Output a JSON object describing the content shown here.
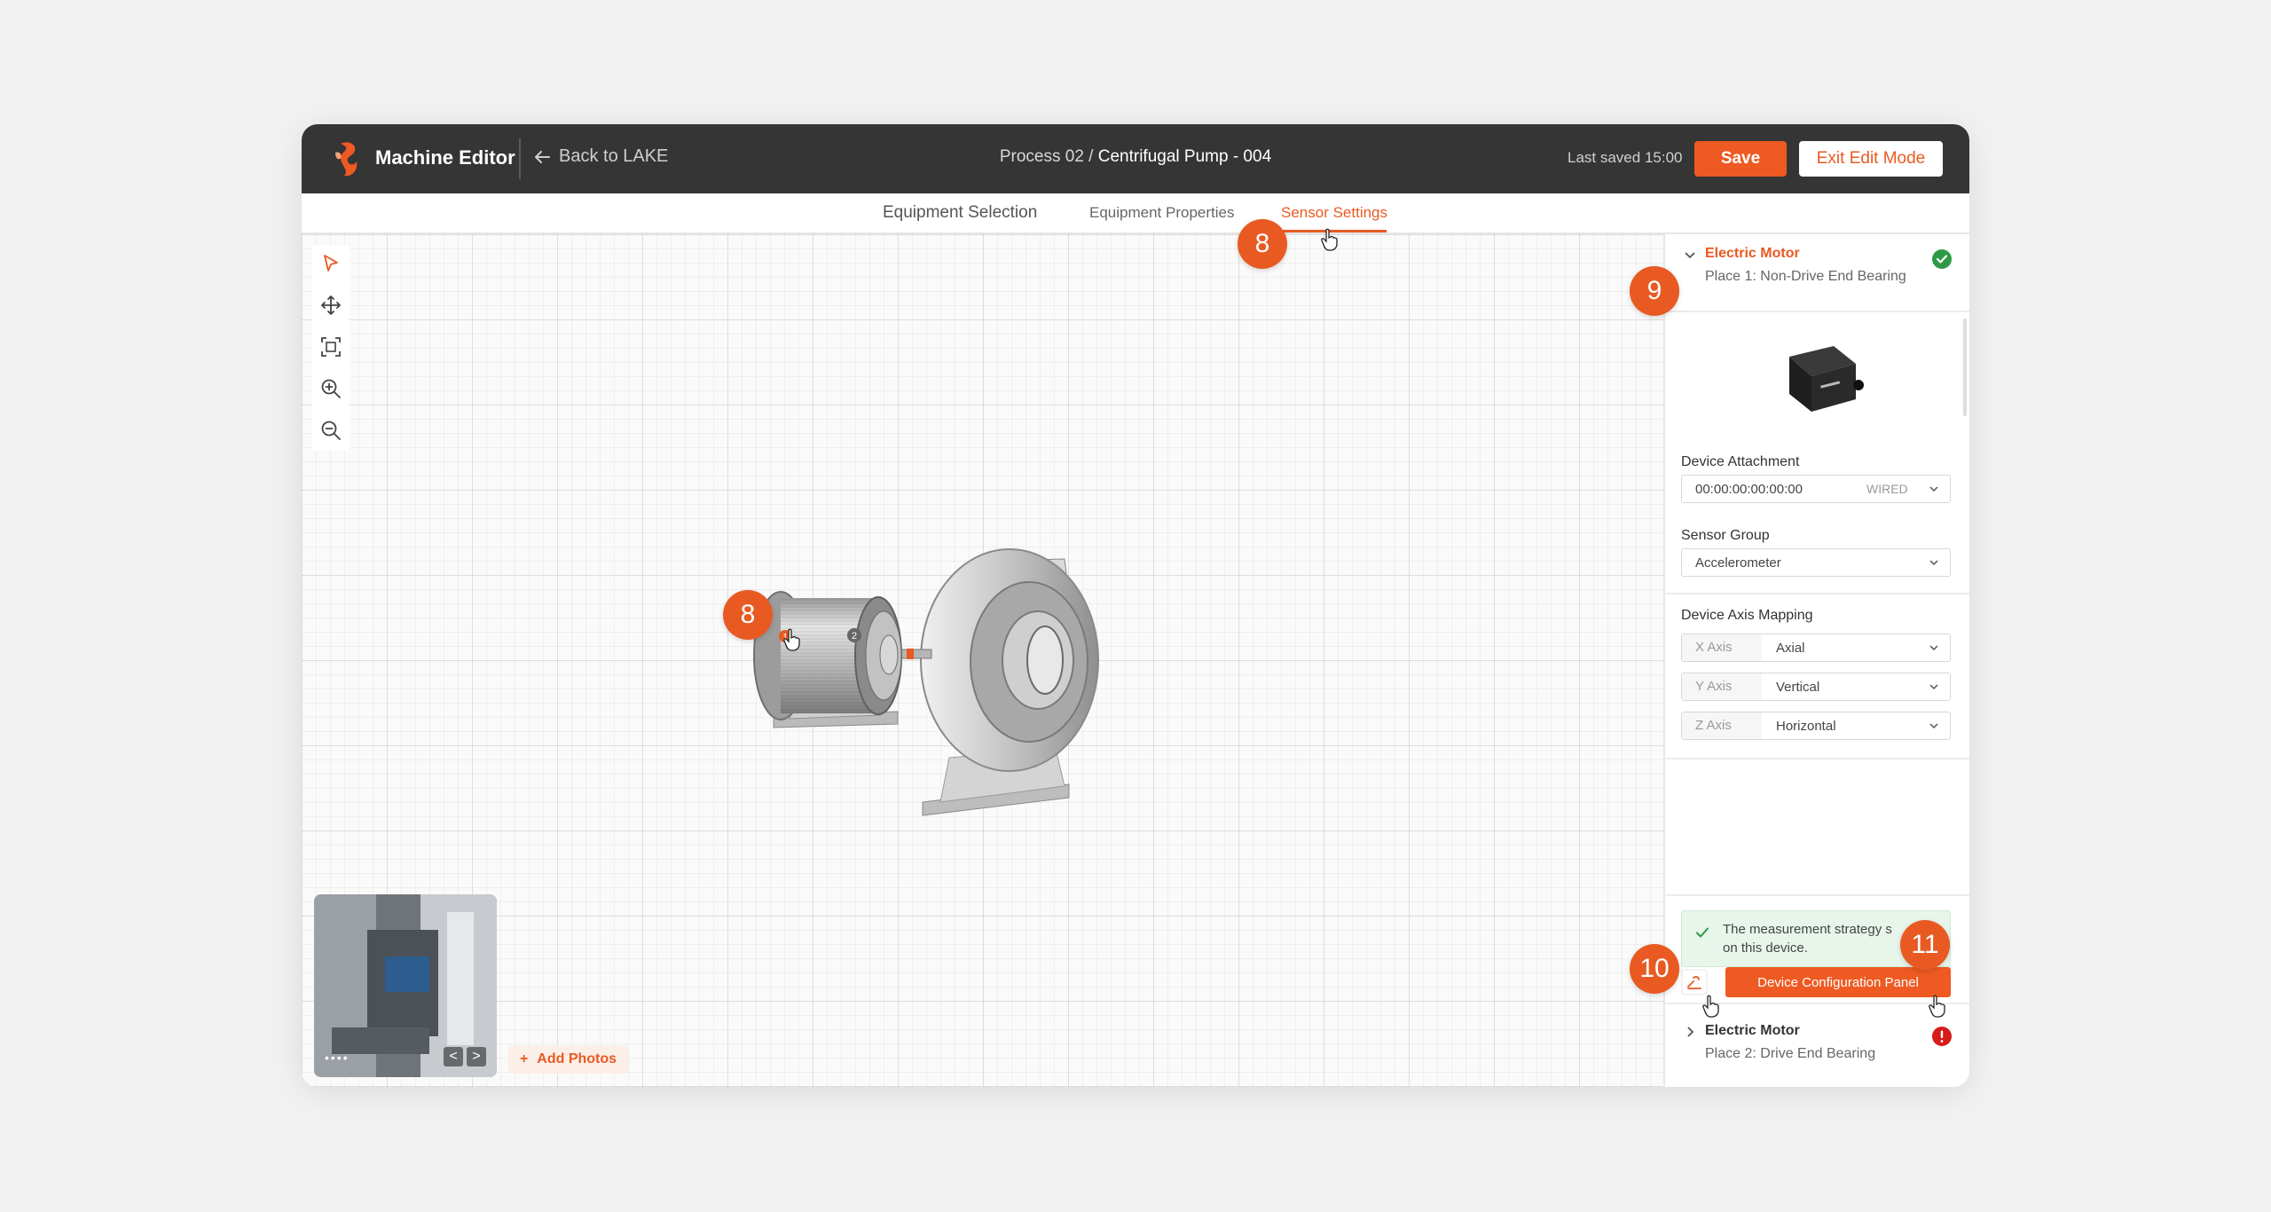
{
  "header": {
    "app_title": "Machine Editor",
    "back_label": "Back to LAKE",
    "breadcrumb_prefix": "Process 02 /",
    "breadcrumb_current": "Centrifugal Pump - 004",
    "last_saved": "Last saved 15:00",
    "save_label": "Save",
    "exit_label": "Exit Edit Mode",
    "accent_color": "#ee5a22"
  },
  "tabs": [
    {
      "label": "Equipment Selection",
      "active": false
    },
    {
      "label": "Equipment Properties",
      "active": false
    },
    {
      "label": "Sensor Settings",
      "active": true
    }
  ],
  "toolbar": {
    "tools": [
      "select-arrow-icon",
      "move-icon",
      "fit-frame-icon",
      "zoom-in-icon",
      "zoom-out-icon"
    ]
  },
  "canvas": {
    "sensor_markers": [
      "1",
      "2"
    ],
    "photos": {
      "add_label": "Add Photos",
      "prev": "<",
      "next": ">",
      "dots": "••••"
    }
  },
  "step_badges": {
    "tab": "8",
    "motor": "8",
    "panel": "9",
    "icon_button": "10",
    "config_button": "11"
  },
  "panel": {
    "place1": {
      "title": "Electric Motor",
      "subtitle": "Place 1: Non-Drive End Bearing",
      "status": "ok",
      "status_color": "#2e9a45"
    },
    "device_attachment": {
      "label": "Device Attachment",
      "value": "00:00:00:00:00:00",
      "connection": "WIRED"
    },
    "sensor_group": {
      "label": "Sensor Group",
      "value": "Accelerometer"
    },
    "axis_mapping": {
      "label": "Device Axis Mapping",
      "rows": [
        {
          "axis": "X Axis",
          "value": "Axial"
        },
        {
          "axis": "Y Axis",
          "value": "Vertical"
        },
        {
          "axis": "Z Axis",
          "value": "Horizontal"
        }
      ]
    },
    "success_message_line1": "The measurement strategy s",
    "success_message_line2": "on this device.",
    "config_button_label": "Device Configuration Panel",
    "place2": {
      "title": "Electric Motor",
      "subtitle": "Place 2: Drive End Bearing",
      "status": "error",
      "status_color": "#d71b1b"
    }
  }
}
